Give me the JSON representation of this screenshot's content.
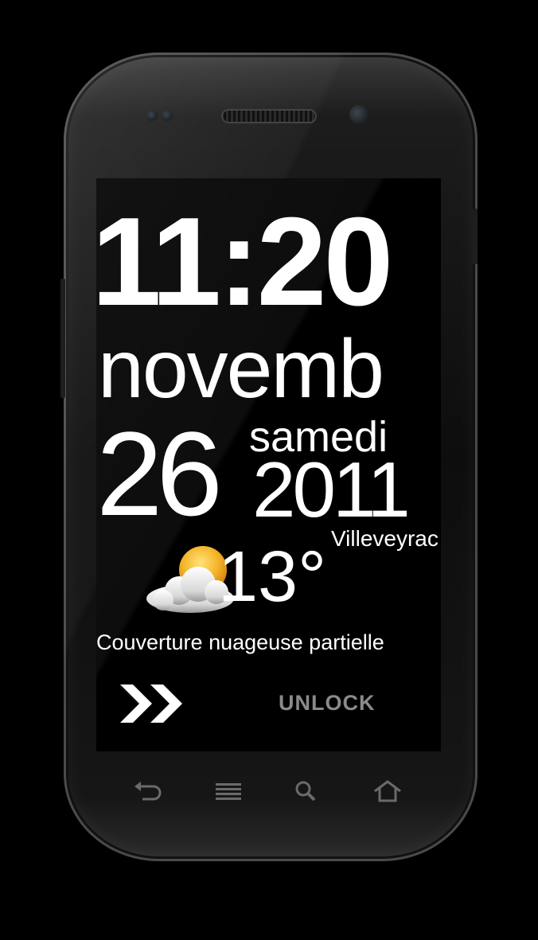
{
  "lockscreen": {
    "time": "11:20",
    "month": "novemb",
    "day": "26",
    "weekday": "samedi",
    "year": "2011",
    "location": "Villeveyrac",
    "temperature": "13°",
    "condition": "Couverture nuageuse partielle",
    "weather_icon": "partly-cloudy-icon",
    "unlock": {
      "label": "UNLOCK",
      "icon": "double-chevron-right-icon"
    }
  },
  "nav_bar": {
    "buttons": [
      {
        "name": "back",
        "icon": "back-arrow-icon"
      },
      {
        "name": "menu",
        "icon": "menu-icon"
      },
      {
        "name": "search",
        "icon": "search-icon"
      },
      {
        "name": "home",
        "icon": "home-icon"
      }
    ]
  },
  "colors": {
    "screen_background": "#000000",
    "text": "#ffffff",
    "unlock_label": "#8a8a8a",
    "sun": "#f5b62a",
    "nav_icons": "#6a6a6a"
  }
}
